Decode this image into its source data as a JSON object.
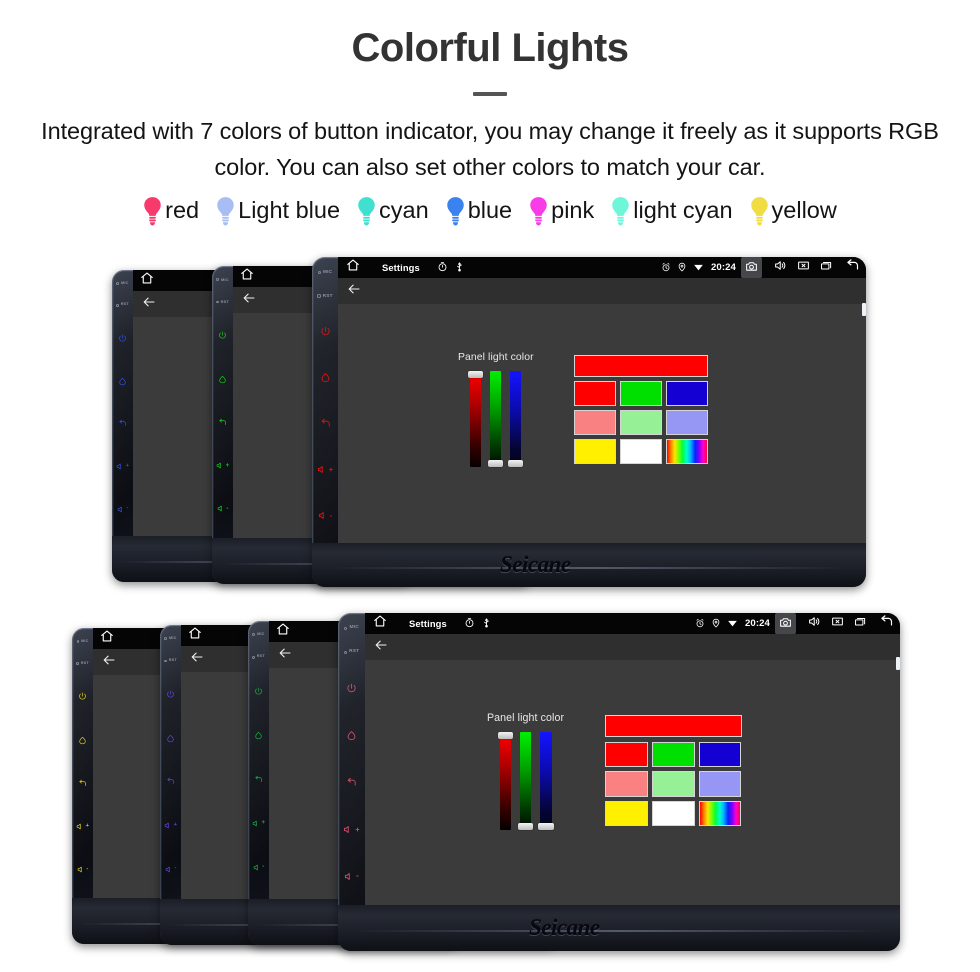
{
  "header": {
    "title": "Colorful Lights",
    "description": "Integrated with 7 colors of button indicator, you may change it freely as it supports RGB color. You can also set other colors to match your car."
  },
  "legend": {
    "items": [
      {
        "label": "red",
        "color": "#f7396b"
      },
      {
        "label": "Light blue",
        "color": "#a9bdf5"
      },
      {
        "label": "cyan",
        "color": "#3fe0d0"
      },
      {
        "label": "blue",
        "color": "#3a82f0"
      },
      {
        "label": "pink",
        "color": "#f73ce8"
      },
      {
        "label": "light cyan",
        "color": "#6ff5d8"
      },
      {
        "label": "yellow",
        "color": "#f0dc43"
      }
    ]
  },
  "device": {
    "brand": "Seicane",
    "side_buttons": [
      {
        "name": "mic-indicator",
        "label": "MIC"
      },
      {
        "name": "reset-indicator",
        "label": "RST"
      },
      {
        "name": "power-button",
        "icon": "power-icon"
      },
      {
        "name": "home-button",
        "icon": "home-icon"
      },
      {
        "name": "back-button",
        "icon": "back-arrow-icon"
      },
      {
        "name": "volume-up-button",
        "icon": "volume-up-icon",
        "label": "+"
      },
      {
        "name": "volume-down-button",
        "icon": "volume-down-icon",
        "label": "-"
      }
    ],
    "statusbar": {
      "title": "Settings",
      "clock": "20:24",
      "left_icons": [
        "home-icon",
        "timer-icon",
        "usb-icon"
      ],
      "right_icons": [
        "alarm-icon",
        "location-icon",
        "wifi-icon"
      ],
      "action_icons": [
        "camera-icon",
        "volume-icon",
        "close-icon",
        "recents-icon",
        "back-icon"
      ]
    },
    "appbar": {
      "back": "back-arrow-icon"
    }
  },
  "picker": {
    "label": "Panel light color",
    "sliders": [
      {
        "channel": "R",
        "value": 255,
        "thumb": "top"
      },
      {
        "channel": "G",
        "value": 0,
        "thumb": "bottom"
      },
      {
        "channel": "B",
        "value": 0,
        "thumb": "bottom"
      }
    ],
    "preview": "#ff0000",
    "swatches": [
      [
        "#ff0000",
        "#00e000",
        "#1400d2"
      ],
      [
        "#fa8181",
        "#96f096",
        "#9696f5"
      ],
      [
        "#fff000",
        "#ffffff",
        "rainbow"
      ]
    ]
  },
  "clusters": {
    "top": {
      "name": "top-device-cluster",
      "units": [
        {
          "name": "device-blue",
          "button_color": "#2f4fe0",
          "expanded": false
        },
        {
          "name": "device-green",
          "button_color": "#18c81e",
          "expanded": false
        },
        {
          "name": "device-red",
          "button_color": "#e01414",
          "expanded": true
        }
      ]
    },
    "bottom": {
      "name": "bottom-device-cluster",
      "units": [
        {
          "name": "device-yellow",
          "button_color": "#dcc814",
          "expanded": false
        },
        {
          "name": "device-purple",
          "button_color": "#5a46d2",
          "expanded": false
        },
        {
          "name": "device-green2",
          "button_color": "#1eaa46",
          "expanded": false
        },
        {
          "name": "device-pink",
          "button_color": "#d2506e",
          "expanded": true
        }
      ]
    }
  }
}
